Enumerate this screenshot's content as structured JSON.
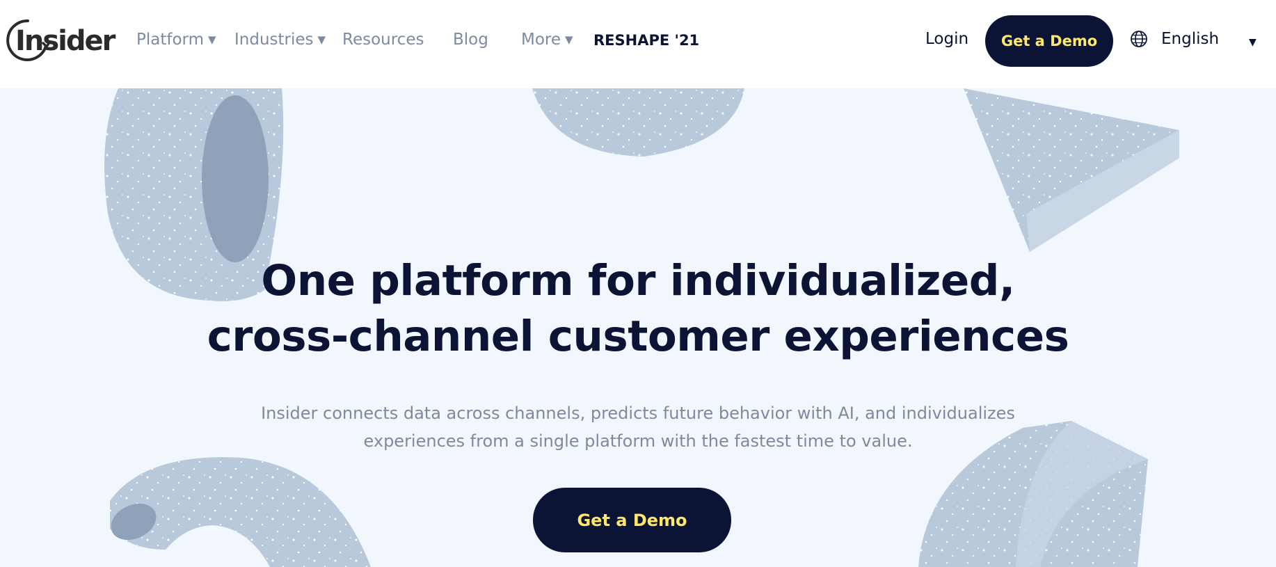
{
  "brand": {
    "logo_text": "Insider"
  },
  "nav": {
    "items": [
      {
        "label": "Platform",
        "has_caret": true
      },
      {
        "label": "Industries",
        "has_caret": true
      },
      {
        "label": "Resources",
        "has_caret": false
      },
      {
        "label": "Blog",
        "has_caret": false
      },
      {
        "label": "More",
        "has_caret": true
      },
      {
        "label": "RESHAPE '21",
        "has_caret": false
      }
    ],
    "login_label": "Login",
    "demo_label": "Get a Demo",
    "language_label": "English"
  },
  "hero": {
    "headline_line1": "One platform for individualized,",
    "headline_line2": "cross-channel customer experiences",
    "subtext_line1": "Insider connects data across channels, predicts future behavior with AI, and individualizes",
    "subtext_line2": "experiences from a single platform with the fastest time to value.",
    "cta_label": "Get a Demo"
  },
  "colors": {
    "navy": "#0b1435",
    "cta_text": "#ffe866",
    "muted_text": "#7c8ba0",
    "hero_bg": "#f2f7fd",
    "shape_fill": "#b4c5d9"
  },
  "icons": [
    "insider-logo-ring-icon",
    "caret-down-icon",
    "globe-icon"
  ]
}
